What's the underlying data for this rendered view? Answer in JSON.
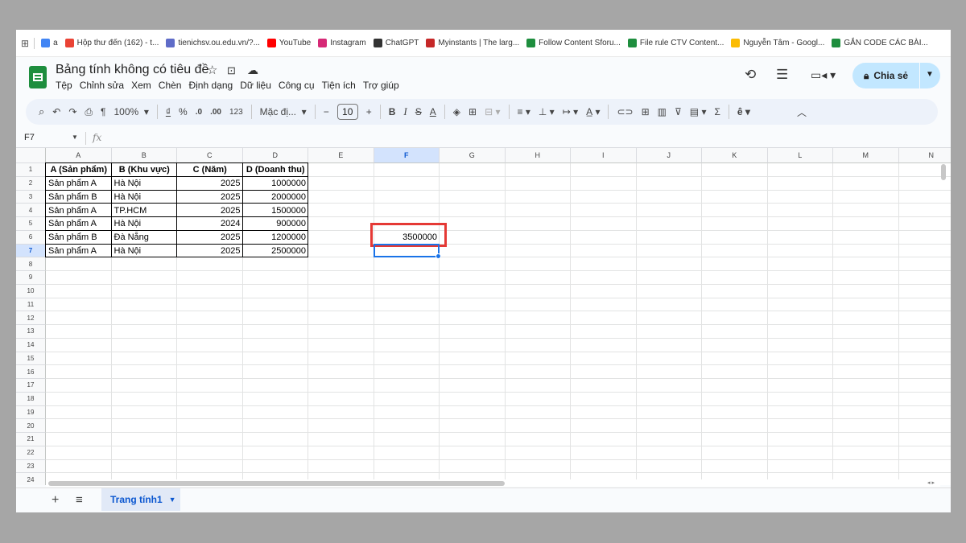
{
  "bookmarks": [
    {
      "label": "a",
      "icon": "google-icon",
      "color": "#4285f4"
    },
    {
      "label": "Hộp thư đến (162) - t...",
      "icon": "gmail-icon",
      "color": "#ea4335"
    },
    {
      "label": "tienichsv.ou.edu.vn/?...",
      "icon": "link-icon",
      "color": "#5f6cc8"
    },
    {
      "label": "YouTube",
      "icon": "youtube-icon",
      "color": "#ff0000"
    },
    {
      "label": "Instagram",
      "icon": "instagram-icon",
      "color": "#d62976"
    },
    {
      "label": "ChatGPT",
      "icon": "chatgpt-icon",
      "color": "#333333"
    },
    {
      "label": "Myinstants | The larg...",
      "icon": "myinstants-icon",
      "color": "#c62828"
    },
    {
      "label": "Follow Content Sforu...",
      "icon": "sheets-icon",
      "color": "#1e8e3e"
    },
    {
      "label": "File rule CTV Content...",
      "icon": "sheets-icon",
      "color": "#1e8e3e"
    },
    {
      "label": "Nguyễn Tâm - Googl...",
      "icon": "drive-icon",
      "color": "#fbbc04"
    },
    {
      "label": "GẮN CODE CÁC BÀI...",
      "icon": "sheets-icon",
      "color": "#1e8e3e"
    }
  ],
  "doc": {
    "title": "Bảng tính không có tiêu đề",
    "menu": [
      "Tệp",
      "Chỉnh sửa",
      "Xem",
      "Chèn",
      "Định dạng",
      "Dữ liệu",
      "Công cụ",
      "Tiện ích",
      "Trợ giúp"
    ],
    "share_label": "Chia sẻ"
  },
  "toolbar": {
    "zoom": "100%",
    "currency": "₫",
    "percent": "%",
    "dec_decrease": ".0",
    "dec_increase": ".00",
    "number_format": "123",
    "font": "Mặc đị...",
    "font_size": "10",
    "bold": "B",
    "italic": "I",
    "strike": "S",
    "text_color": "A"
  },
  "formula_bar": {
    "name_box": "F7",
    "fx": "fx"
  },
  "grid": {
    "columns": [
      "A",
      "B",
      "C",
      "D",
      "E",
      "F",
      "G",
      "H",
      "I",
      "J",
      "K",
      "L",
      "M",
      "N"
    ],
    "selected_column": "F",
    "selected_row": "7",
    "rows": [
      "1",
      "2",
      "3",
      "4",
      "5",
      "6",
      "7",
      "8",
      "9",
      "10",
      "11",
      "12",
      "13",
      "14",
      "15",
      "16",
      "17",
      "18",
      "19",
      "20",
      "21",
      "22",
      "23",
      "24"
    ],
    "headers": [
      "A (Sản phẩm)",
      "B (Khu vực)",
      "C (Năm)",
      "D (Doanh thu)"
    ],
    "data": [
      [
        "Sản phẩm A",
        "Hà Nội",
        "2025",
        "1000000"
      ],
      [
        "Sản phẩm B",
        "Hà Nội",
        "2025",
        "2000000"
      ],
      [
        "Sản phẩm A",
        "TP.HCM",
        "2025",
        "1500000"
      ],
      [
        "Sản phẩm A",
        "Hà Nội",
        "2024",
        "900000"
      ],
      [
        "Sản phẩm B",
        "Đà Nẵng",
        "2025",
        "1200000"
      ],
      [
        "Sản phẩm A",
        "Hà Nội",
        "2025",
        "2500000"
      ]
    ],
    "result_cell": {
      "ref": "F6",
      "value": "3500000"
    },
    "highlight_color": "#e53935",
    "selection_color": "#1a73e8"
  },
  "sheets": {
    "tabs": [
      "Trang tính1"
    ]
  }
}
